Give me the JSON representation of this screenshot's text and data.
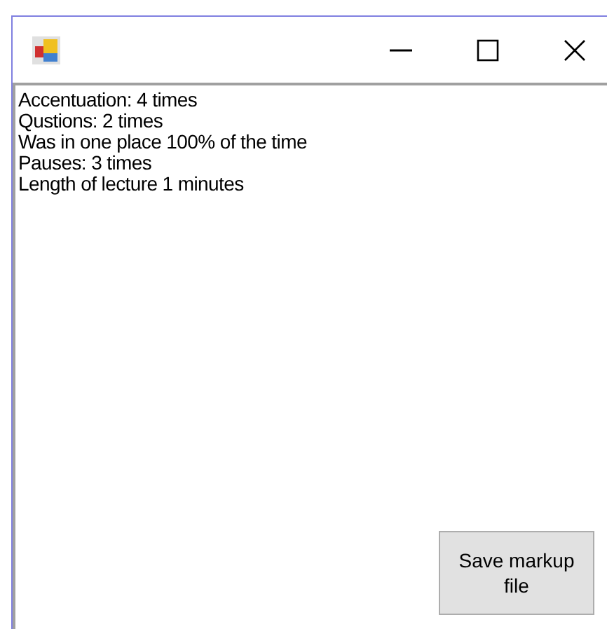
{
  "lines": [
    "Accentuation: 4 times",
    "Qustions: 2 times",
    "Was in one place 100% of the time",
    "Pauses: 3 times",
    "Length of lecture 1 minutes"
  ],
  "buttons": [
    "Save markup file"
  ]
}
